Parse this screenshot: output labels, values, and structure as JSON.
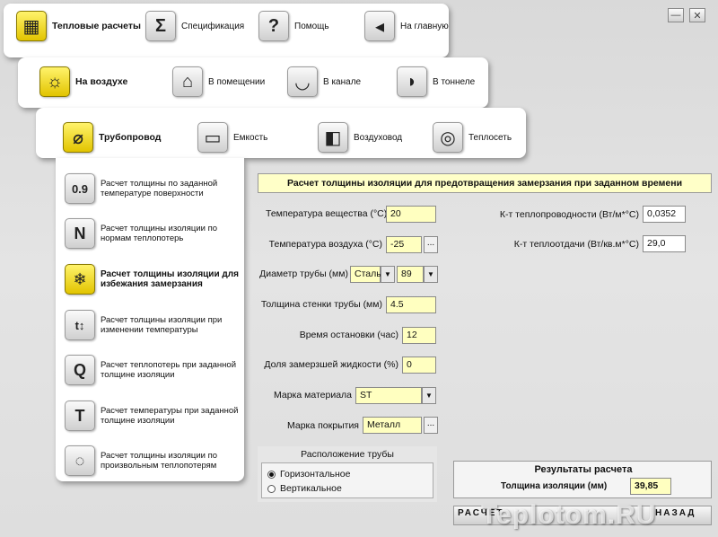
{
  "top_nav": [
    {
      "label": "Тепловые расчеты",
      "icon": "calculator-icon",
      "glyph": "▦",
      "active": true
    },
    {
      "label": "Спецификация",
      "icon": "sigma-icon",
      "glyph": "Σ",
      "active": false
    },
    {
      "label": "Помощь",
      "icon": "question-icon",
      "glyph": "?",
      "active": false
    },
    {
      "label": "На главную",
      "icon": "back-arrow-icon",
      "glyph": "◂",
      "active": false
    }
  ],
  "env_nav": [
    {
      "label": "На воздухе",
      "icon": "sun-icon",
      "glyph": "☼",
      "active": true
    },
    {
      "label": "В помещении",
      "icon": "house-icon",
      "glyph": "⌂",
      "active": false
    },
    {
      "label": "В канале",
      "icon": "channel-icon",
      "glyph": "◡",
      "active": false
    },
    {
      "label": "В тоннеле",
      "icon": "tunnel-icon",
      "glyph": "◗",
      "active": false
    }
  ],
  "obj_nav": [
    {
      "label": "Трубопровод",
      "icon": "pipe-icon",
      "glyph": "⌀",
      "active": true
    },
    {
      "label": "Емкость",
      "icon": "tank-icon",
      "glyph": "▭",
      "active": false
    },
    {
      "label": "Воздуховод",
      "icon": "duct-icon",
      "glyph": "◧",
      "active": false
    },
    {
      "label": "Теплосеть",
      "icon": "heat-network-icon",
      "glyph": "◎",
      "active": false
    }
  ],
  "side_items": [
    {
      "label": "Расчет толщины по заданной температуре поверхности",
      "icon": "temperature-display-icon",
      "glyph": "0.9",
      "active": false
    },
    {
      "label": "Расчет толщины изоляции по нормам теплопотерь",
      "icon": "norm-n-icon",
      "glyph": "N",
      "active": false
    },
    {
      "label": "Расчет толщины изоляции для избежания замерзания",
      "icon": "snowflake-icon",
      "glyph": "❄",
      "active": true
    },
    {
      "label": "Расчет толщины изоляции при изменении температуры",
      "icon": "temp-change-icon",
      "glyph": "t↕",
      "active": false
    },
    {
      "label": "Расчет теплопотерь при заданной толщине изоляции",
      "icon": "heat-loss-q-icon",
      "glyph": "Q",
      "active": false
    },
    {
      "label": "Расчет температуры при заданной толщине изоляции",
      "icon": "temperature-t-icon",
      "glyph": "T",
      "active": false
    },
    {
      "label": "Расчет толщины изоляции по произвольным теплопотерям",
      "icon": "custom-heat-loss-icon",
      "glyph": "◌",
      "active": false
    }
  ],
  "form": {
    "title": "Расчет толщины изоляции для предотвращения замерзания при заданном времени",
    "substance_temp_label": "Температура вещества (°С)",
    "substance_temp_value": "20",
    "air_temp_label": "Температура воздуха (°С)",
    "air_temp_value": "-25",
    "pipe_diameter_label": "Диаметр трубы (мм)",
    "pipe_material_value": "Сталь",
    "pipe_diameter_value": "89",
    "wall_thickness_label": "Толщина стенки трубы (мм)",
    "wall_thickness_value": "4.5",
    "stop_time_label": "Время остановки (час)",
    "stop_time_value": "12",
    "frozen_share_label": "Доля замерзшей жидкости (%)",
    "frozen_share_value": "0",
    "material_label": "Марка материала",
    "material_value": "ST",
    "coating_label": "Марка покрытия",
    "coating_value": "Металл",
    "conductivity_label": "К-т теплопроводности (Вт/м*°С)",
    "conductivity_value": "0,0352",
    "heat_transfer_label": "К-т теплоотдачи (Вт/кв.м*°С)",
    "heat_transfer_value": "29,0",
    "ellipsis": "..."
  },
  "placement": {
    "title": "Расположение трубы",
    "options": [
      {
        "label": "Горизонтальное",
        "checked": true
      },
      {
        "label": "Вертикальное",
        "checked": false
      }
    ]
  },
  "results": {
    "title": "Результаты расчета",
    "thickness_label": "Толщина изоляции (мм)",
    "thickness_value": "39,85"
  },
  "bottom_bar": {
    "calc_button": "РАСЧЕТ",
    "watermark": "Teplotom.RU",
    "back_button": "НАЗАД"
  },
  "colors": {
    "input_bg": "#ffffc0",
    "active_icon": "#f5e000"
  }
}
